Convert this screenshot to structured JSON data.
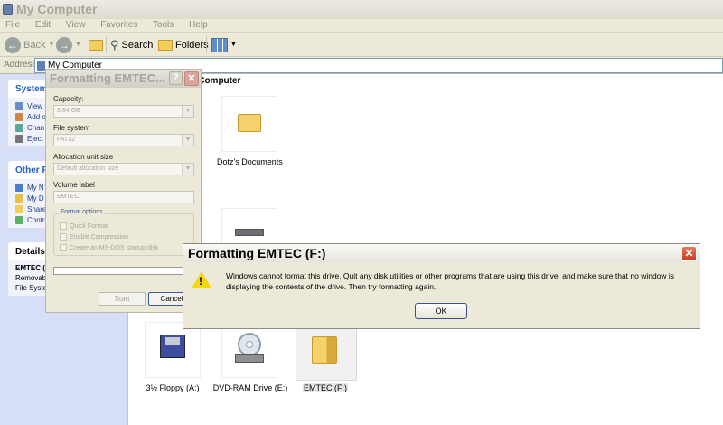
{
  "window": {
    "title": "My Computer"
  },
  "menu": [
    "File",
    "Edit",
    "View",
    "Favorites",
    "Tools",
    "Help"
  ],
  "toolbar": {
    "back": "Back",
    "search": "Search",
    "folders": "Folders"
  },
  "address": {
    "label": "Address",
    "value": "My Computer"
  },
  "left_pane": {
    "system": {
      "header": "System",
      "items": [
        "View",
        "Add o",
        "Chan",
        "Eject"
      ]
    },
    "other": {
      "header": "Other Pla",
      "items": [
        "My N",
        "My D",
        "Share",
        "Contr"
      ]
    },
    "details": {
      "header": "Details",
      "name": "EMTEC (F",
      "type": "Removab",
      "fs": "File Syster"
    }
  },
  "content": {
    "group_header": "his Computer",
    "items": [
      {
        "label": "s"
      },
      {
        "label": "Dotz's Documents"
      },
      {
        "label": "3½ Floppy (A:)"
      },
      {
        "label": "DVD-RAM Drive (E:)"
      },
      {
        "label": "EMTEC (F:)"
      }
    ]
  },
  "format_dialog": {
    "title": "Formatting EMTEC...",
    "help": "?",
    "capacity_label": "Capacity:",
    "capacity_value": "3.84 GB",
    "fs_label": "File system",
    "fs_value": "FAT32",
    "alloc_label": "Allocation unit size",
    "alloc_value": "Default allocation size",
    "volume_label": "Volume label",
    "volume_value": "EMTEC",
    "options_legend": "Format options",
    "options": [
      "Quick Format",
      "Enable Compression",
      "Create an MS-DOS startup disk"
    ],
    "start": "Start",
    "cancel": "Cancel"
  },
  "error_dialog": {
    "title": "Formatting EMTEC (F:)",
    "message": "Windows cannot format this drive. Quit any disk utilities or other programs that are using this drive, and make sure that no window is displaying the contents of the drive. Then try formatting again.",
    "ok": "OK"
  }
}
